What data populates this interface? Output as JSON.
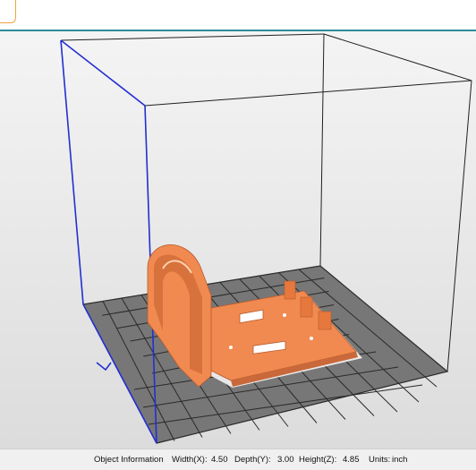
{
  "status": {
    "object_info_label": "Object Information",
    "width_label": "Width(X):",
    "width_value": "4.50",
    "depth_label": "Depth(Y):",
    "depth_value": "3.00",
    "height_label": "Height(Z):",
    "height_value": "4.85",
    "units_label": "Units:",
    "units_value": "inch"
  },
  "colors": {
    "accent": "#2f8c98",
    "model": "#f08a50",
    "z_axis": "#2330d0",
    "bed_dark": "#555555",
    "bed_light": "#8a8a8a"
  }
}
